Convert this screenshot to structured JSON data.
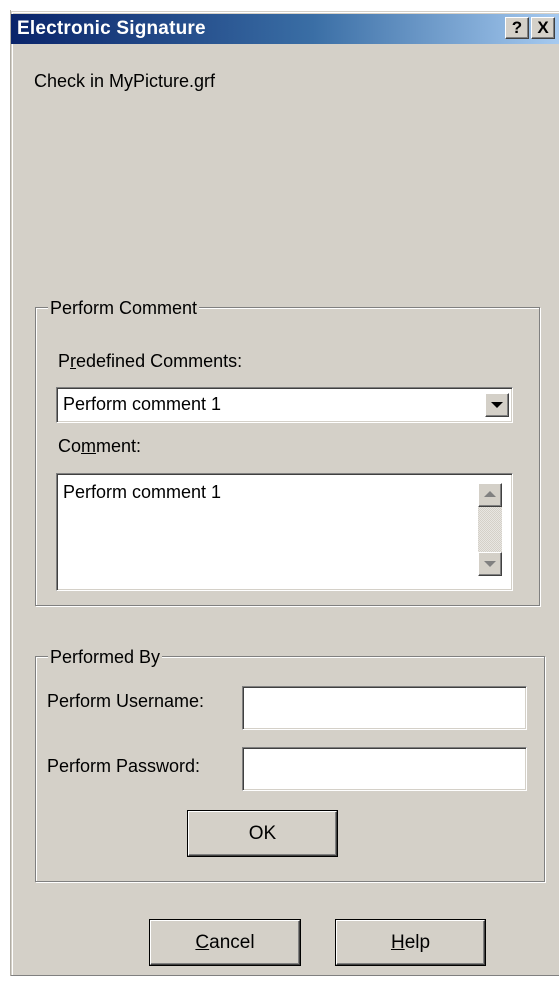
{
  "window": {
    "title": "Electronic Signature",
    "help_button": "?",
    "close_button": "X"
  },
  "action_text": "Check in MyPicture.grf",
  "perform_comment": {
    "group_label": "Perform Comment",
    "predefined_label_pre": "P",
    "predefined_label_mnemonic": "r",
    "predefined_label_post": "edefined Comments:",
    "predefined_selected": "Perform comment 1",
    "comment_label_pre": "Co",
    "comment_label_mnemonic": "m",
    "comment_label_post": "ment:",
    "comment_value": "Perform comment 1"
  },
  "performed_by": {
    "group_label": "Performed By",
    "username_label": "Perform Username:",
    "username_value": "",
    "password_label": "Perform Password:",
    "password_value": "",
    "ok_label": "OK"
  },
  "footer": {
    "cancel_mnemonic": "C",
    "cancel_rest": "ancel",
    "help_mnemonic": "H",
    "help_rest": "elp"
  },
  "icons": {
    "dropdown": "chevron-down-icon",
    "scroll_up": "scroll-up-arrow-icon",
    "scroll_down": "scroll-down-arrow-icon",
    "help": "question-mark-icon",
    "close": "close-icon"
  },
  "colors": {
    "titlebar_start": "#0a246a",
    "titlebar_end": "#a6caf0",
    "dialog_face": "#d4d0c8"
  }
}
